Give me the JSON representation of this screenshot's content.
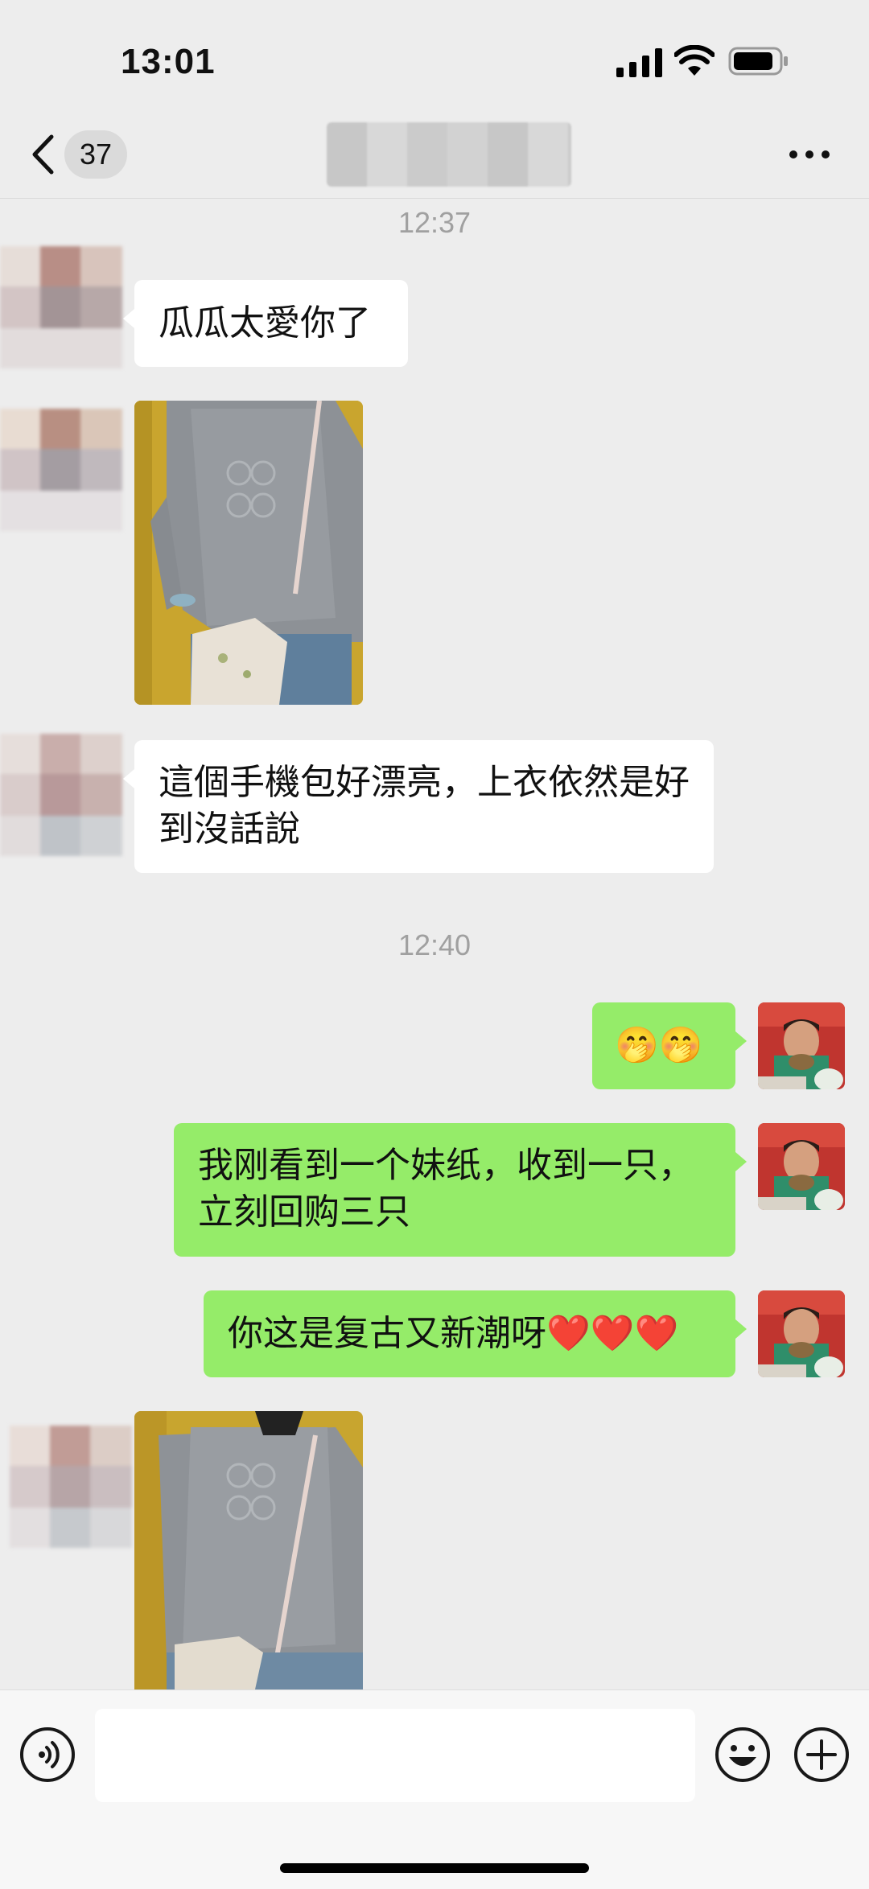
{
  "status_bar": {
    "time": "13:01"
  },
  "nav": {
    "unread_count": "37"
  },
  "timestamps": [
    "12:37",
    "12:40"
  ],
  "messages": [
    {
      "side": "left",
      "text": "瓜瓜太愛你了"
    },
    {
      "side": "left",
      "text": "這個手機包好漂亮，上衣依然是好到沒話說"
    },
    {
      "side": "right",
      "text": "🤭🤭"
    },
    {
      "side": "right",
      "text": "我刚看到一个妹纸，收到一只，立刻回购三只"
    },
    {
      "side": "right",
      "text": "你这是复古又新潮呀❤️❤️❤️"
    }
  ],
  "colors": {
    "bubble_self": "#95ec69",
    "bubble_other": "#ffffff",
    "background": "#ededed"
  }
}
